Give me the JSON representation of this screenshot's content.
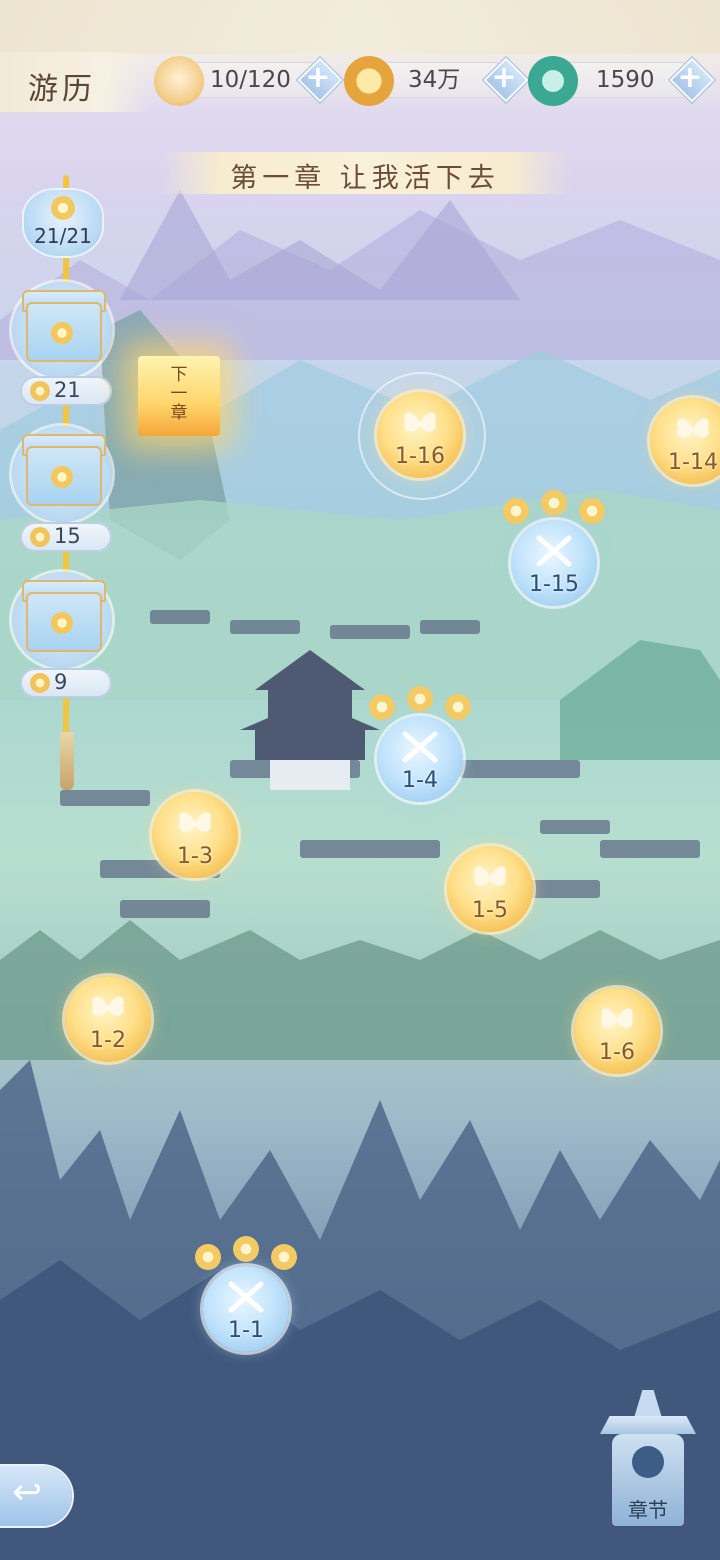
{
  "header": {
    "title": "游历",
    "resources": [
      {
        "name": "stamina",
        "icon": "cat-face-icon",
        "value": "10/120"
      },
      {
        "name": "coins",
        "icon": "paw-coin-icon",
        "value": "34万"
      },
      {
        "name": "jade",
        "icon": "jade-dragon-icon",
        "value": "1590"
      }
    ]
  },
  "chapter": {
    "title": "第一章 让我活下去"
  },
  "progress": {
    "stars": "21/21",
    "rewards": [
      {
        "cost": "21"
      },
      {
        "cost": "15"
      },
      {
        "cost": "9"
      }
    ]
  },
  "next_chapter": {
    "label": "下一章"
  },
  "stages": [
    {
      "id": "1-16",
      "type": "boss"
    },
    {
      "id": "1-14",
      "type": "boss"
    },
    {
      "id": "1-15",
      "type": "battle"
    },
    {
      "id": "1-4",
      "type": "battle"
    },
    {
      "id": "1-3",
      "type": "boss"
    },
    {
      "id": "1-5",
      "type": "boss"
    },
    {
      "id": "1-2",
      "type": "boss"
    },
    {
      "id": "1-6",
      "type": "boss"
    },
    {
      "id": "1-1",
      "type": "battle"
    }
  ],
  "controls": {
    "back_icon": "back-arrow-icon",
    "chapter_label": "章节"
  },
  "colors": {
    "gold": "#f3b94a",
    "blue_node": "#8fc2ea",
    "title_text": "#5a4636"
  }
}
